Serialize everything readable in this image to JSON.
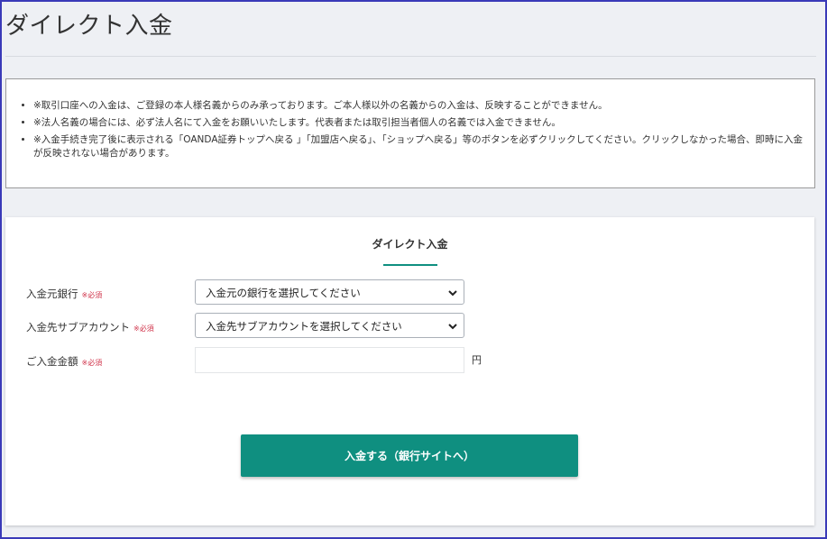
{
  "header": {
    "title": "ダイレクト入金"
  },
  "notices": [
    "※取引口座への入金は、ご登録の本人様名義からのみ承っております。ご本人様以外の名義からの入金は、反映することができません。",
    "※法人名義の場合には、必ず法人名にて入金をお願いいたします。代表者または取引担当者個人の名義では入金できません。",
    "※入金手続き完了後に表示される「OANDA証券トップへ戻る 」「加盟店へ戻る」、「ショップへ戻る」等のボタンを必ずクリックしてください。クリックしなかった場合、即時に入金が反映されない場合があります。"
  ],
  "form": {
    "title": "ダイレクト入金",
    "required_mark": "※必須",
    "source_bank": {
      "label": "入金元銀行",
      "value": "入金元の銀行を選択してください"
    },
    "sub_account": {
      "label": "入金先サブアカウント",
      "value": "入金先サブアカウントを選択してください"
    },
    "amount": {
      "label": "ご入金金額",
      "value": "",
      "unit": "円"
    },
    "submit_label": "入金する（銀行サイトへ）"
  },
  "colors": {
    "accent": "#0f8f80",
    "required": "#d0334a",
    "frame": "#3a3ab8"
  }
}
